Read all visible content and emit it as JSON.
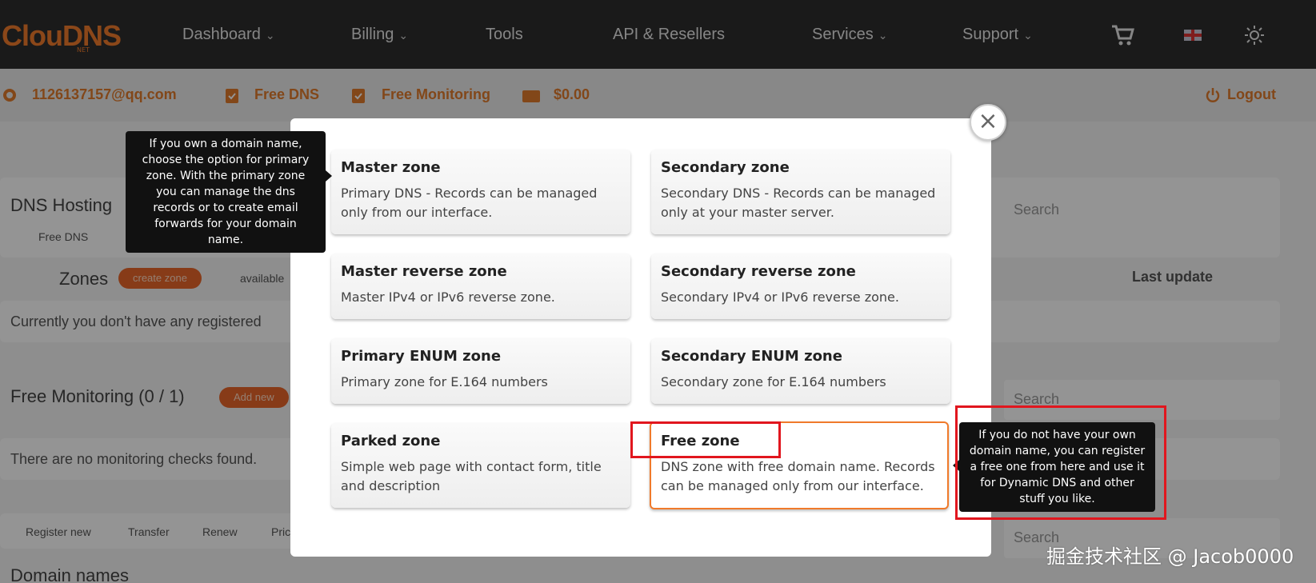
{
  "brand": {
    "logo": "ClouDNS",
    "logo_sub": "NET"
  },
  "nav": {
    "items": [
      {
        "label": "Dashboard",
        "has_caret": true
      },
      {
        "label": "Billing",
        "has_caret": true
      },
      {
        "label": "Tools",
        "has_caret": false
      },
      {
        "label": "API & Resellers",
        "has_caret": false
      },
      {
        "label": "Services",
        "has_caret": true
      },
      {
        "label": "Support",
        "has_caret": true
      }
    ],
    "icons": [
      "cart-icon",
      "flag-icon",
      "sun-icon"
    ]
  },
  "subbar": {
    "email": "1126137157@qq.com",
    "free_dns": "Free DNS",
    "free_monitoring": "Free Monitoring",
    "balance": "$0.00",
    "logout": "Logout"
  },
  "background": {
    "dns_hosting": "DNS Hosting",
    "free_dns_small": "Free DNS",
    "zones": "Zones",
    "create_zone": "create zone",
    "available": "available",
    "last_update": "Last update",
    "no_zones": "Currently you don't have any registered",
    "free_monitoring_title": "Free Monitoring (0 / 1)",
    "add_new": "Add new",
    "no_checks": "There are no monitoring checks found.",
    "tabs": [
      "Register new",
      "Transfer",
      "Renew",
      "Pric"
    ],
    "domain_names": "Domain names",
    "search_placeholder": "Search"
  },
  "modal": {
    "close": "×",
    "zones": [
      {
        "title": "Master zone",
        "desc": "Primary DNS - Records can be managed only from our interface."
      },
      {
        "title": "Secondary zone",
        "desc": "Secondary DNS - Records can be managed only at your master server."
      },
      {
        "title": "Master reverse zone",
        "desc": "Master IPv4 or IPv6 reverse zone."
      },
      {
        "title": "Secondary reverse zone",
        "desc": "Secondary IPv4 or IPv6 reverse zone."
      },
      {
        "title": "Primary ENUM zone",
        "desc": "Primary zone for E.164 numbers"
      },
      {
        "title": "Secondary ENUM zone",
        "desc": "Secondary zone for E.164 numbers"
      },
      {
        "title": "Parked zone",
        "desc": "Simple web page with contact form, title and description"
      },
      {
        "title": "Free zone",
        "desc": "DNS zone with free domain name. Records can be managed only from our interface."
      }
    ]
  },
  "tooltips": {
    "primary": "If you own a domain name, choose the option for primary zone. With the primary zone you can manage the dns records or to create email forwards for your domain name.",
    "free": "If you do not have your own domain name, you can register a free one from here and use it for Dynamic DNS and other stuff you like."
  },
  "watermark": "掘金技术社区 @ Jacob0000",
  "colors": {
    "accent": "#f07a2b",
    "nav_bg": "#2e2e2e",
    "highlight": "#e1161e"
  }
}
